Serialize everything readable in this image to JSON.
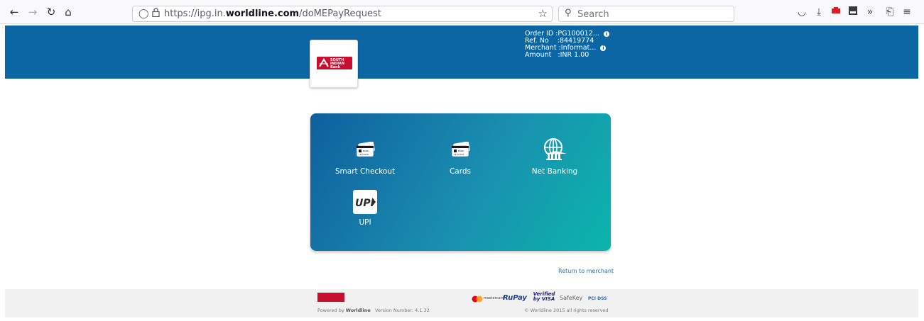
{
  "browser": {
    "url_prefix": "https://ipg.in.",
    "url_domain": "worldline.com",
    "url_path": "/doMEPayRequest",
    "search_placeholder": "Search"
  },
  "header": {
    "bank_name_line1": "SOUTH",
    "bank_name_line2": "INDIAN Bank",
    "order_id_label": "Order ID",
    "order_id_value": "PG100012...",
    "ref_no_label": "Ref. No",
    "ref_no_value": "84419774",
    "merchant_label": "Merchant",
    "merchant_value": "Informat...",
    "amount_label": "Amount",
    "amount_value": "INR 1.00"
  },
  "payment_options": [
    {
      "label": "Smart Checkout",
      "icon": "card-icon"
    },
    {
      "label": "Cards",
      "icon": "card-icon"
    },
    {
      "label": "Net Banking",
      "icon": "globe-bank-icon"
    },
    {
      "label": "UPI",
      "icon": "upi-icon"
    }
  ],
  "card_icon_text": {
    "bank": "BANK",
    "digits": "1234 5678"
  },
  "upi_text": "UPI",
  "return_link": "Return to merchant",
  "footer": {
    "powered_by": "Powered by",
    "brand": "Worldline",
    "version": "Version Number: 4.1.32",
    "copyright": "© Worldline 2015 all rights reserved",
    "brands": [
      "mastercard",
      "RuPay",
      "Verified by VISA",
      "SafeKey",
      "PCI DSS"
    ]
  },
  "colors": {
    "header": "#0c66a3",
    "panel_start": "#0f5f9e",
    "panel_end": "#0bb5ac",
    "bank_red": "#c8102e"
  }
}
